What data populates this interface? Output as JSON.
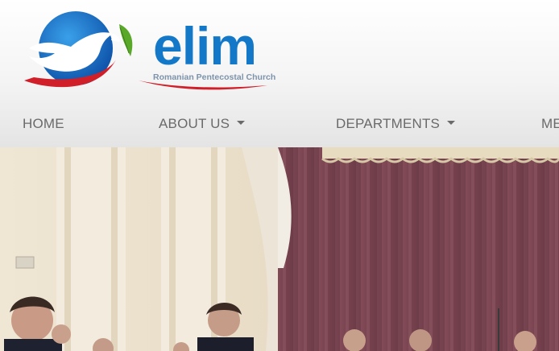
{
  "brand": {
    "name": "elim",
    "tagline": "Romanian Pentecostal Church"
  },
  "nav": {
    "items": [
      {
        "label": "HOME"
      },
      {
        "label": "ABOUT US"
      },
      {
        "label": "DEPARTMENTS"
      },
      {
        "label": "ME"
      }
    ]
  },
  "colors": {
    "brand_blue": "#1478c8",
    "brand_red": "#d11f2a",
    "leaf_green": "#5aa82a",
    "curtain": "#7d4652",
    "nav_text": "#6a6a6a"
  }
}
